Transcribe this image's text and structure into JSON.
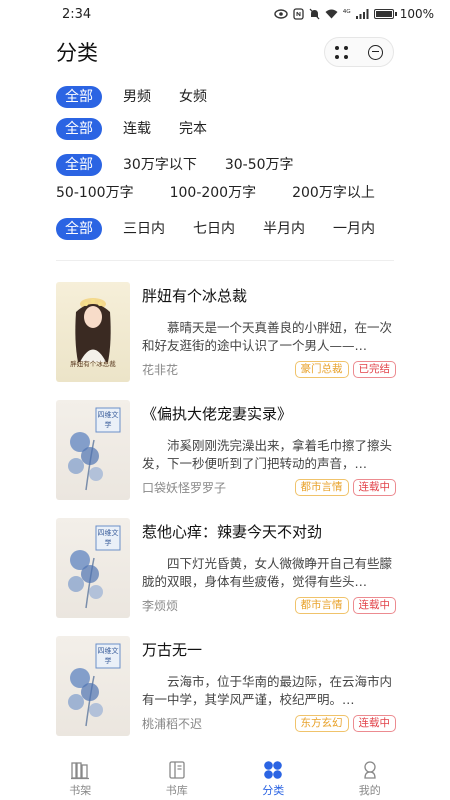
{
  "status_bar": {
    "time": "2:34",
    "signal_text": "⁴ᴳ",
    "battery": "100%"
  },
  "header": {
    "title": "分类"
  },
  "filters": [
    [
      "全部",
      "男频",
      "女频"
    ],
    [
      "全部",
      "连载",
      "完本"
    ],
    [
      "全部",
      "30万字以下",
      "30-50万字",
      "50-100万字",
      "100-200万字",
      "200万字以上"
    ],
    [
      "全部",
      "三日内",
      "七日内",
      "半月内",
      "一月内"
    ]
  ],
  "books": [
    {
      "title": "胖妞有个冰总裁",
      "desc": "慕晴天是一个天真善良的小胖妞，在一次和好友逛街的途中认识了一个男人——…",
      "author": "花非花",
      "tags": [
        {
          "text": "豪门总裁",
          "color": "orange"
        },
        {
          "text": "已完结",
          "color": "red"
        }
      ],
      "cover_text": "胖妞有个冰总裁"
    },
    {
      "title": "《偏执大佬宠妻实录》",
      "desc": "沛奚刚刚洗完澡出来，拿着毛巾擦了擦头发，下一秒便听到了门把转动的声音，…",
      "author": "口袋妖怪罗罗子",
      "tags": [
        {
          "text": "都市言情",
          "color": "orange"
        },
        {
          "text": "连载中",
          "color": "red"
        }
      ],
      "cover_text": "四维文学"
    },
    {
      "title": "惹他心痒：辣妻今天不对劲",
      "desc": "四下灯光昏黄，女人微微睁开自己有些朦胧的双眼，身体有些疲倦，觉得有些头…",
      "author": "李烦烦",
      "tags": [
        {
          "text": "都市言情",
          "color": "orange"
        },
        {
          "text": "连载中",
          "color": "red"
        }
      ],
      "cover_text": "四维文学"
    },
    {
      "title": "万古无一",
      "desc": "云海市，位于华南的最边际，在云海市内有一中学，其学风严谨，校纪严明。…",
      "author": "桃浦稻不迟",
      "tags": [
        {
          "text": "东方玄幻",
          "color": "orange"
        },
        {
          "text": "连载中",
          "color": "red"
        }
      ],
      "cover_text": "四维文学"
    }
  ],
  "nav": [
    {
      "label": "书架",
      "icon": "bookshelf-icon"
    },
    {
      "label": "书库",
      "icon": "library-icon"
    },
    {
      "label": "分类",
      "icon": "category-icon",
      "active": true
    },
    {
      "label": "我的",
      "icon": "profile-icon"
    }
  ],
  "colors": {
    "accent": "#2b64e3",
    "tag_orange": "#e8a22b",
    "tag_red": "#e2434a"
  }
}
